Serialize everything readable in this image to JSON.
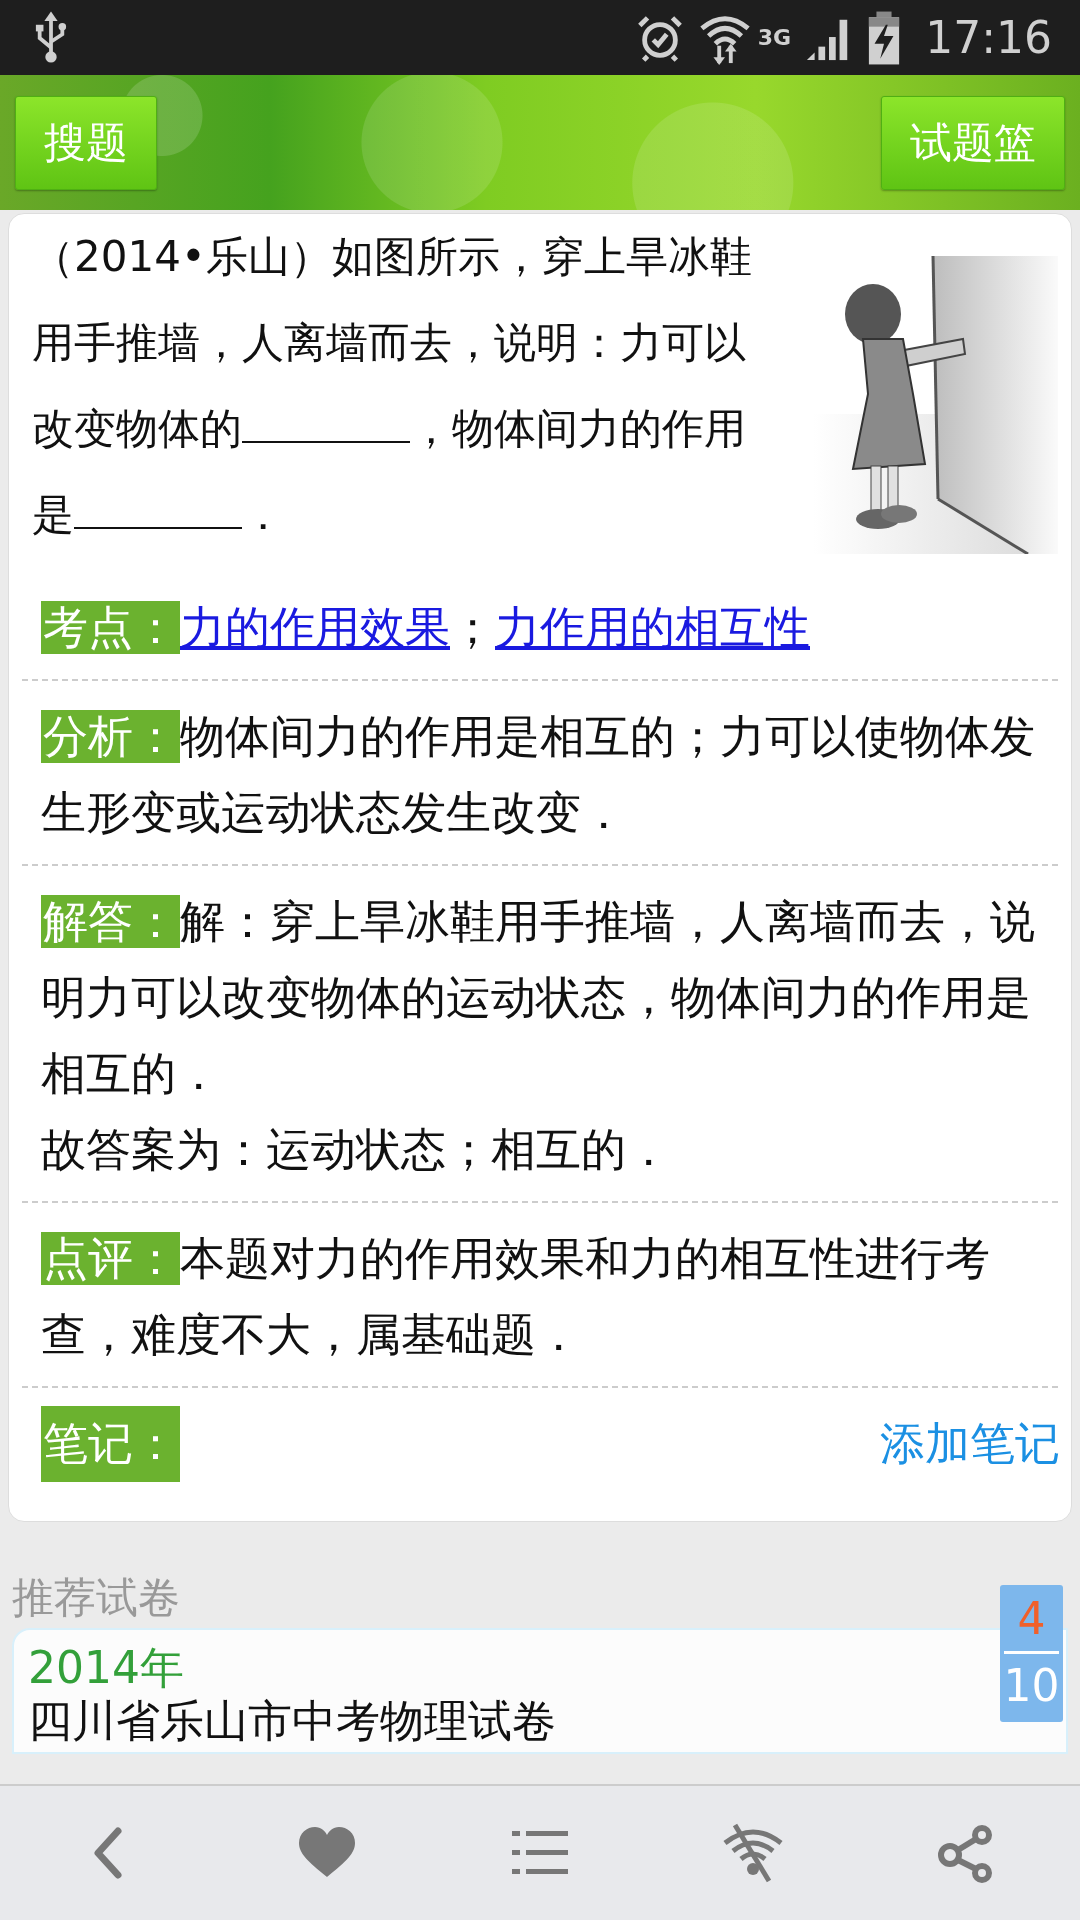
{
  "status_bar": {
    "network": "3G",
    "time": "17:16"
  },
  "header": {
    "left_button": "搜题",
    "right_button": "试题篮"
  },
  "question": {
    "parts": [
      {
        "kind": "text",
        "text": "（2014•乐山）如图所示，穿上旱冰鞋用手推墙，人离墙而去，说明：力可以改变物体的"
      },
      {
        "kind": "blank"
      },
      {
        "kind": "text",
        "text": "，物体间力的作用是"
      },
      {
        "kind": "blank"
      },
      {
        "kind": "text",
        "text": "．"
      }
    ]
  },
  "sections": [
    {
      "kind": "links",
      "label": "考点：",
      "links": [
        "力的作用效果",
        "力作用的相互性"
      ],
      "separator": "；"
    },
    {
      "kind": "text",
      "label": "分析：",
      "lines": [
        "物体间力的作用是相互的；力可以使物体发生形变或运动状态发生改变．"
      ]
    },
    {
      "kind": "text",
      "label": "解答：",
      "lines": [
        "解：穿上旱冰鞋用手推墙，人离墙而去，说明力可以改变物体的运动状态，物体间力的作用是相互的．",
        "故答案为：运动状态；相互的．"
      ]
    },
    {
      "kind": "text",
      "label": "点评：",
      "lines": [
        "本题对力的作用效果和力的相互性进行考查，难度不大，属基础题．"
      ]
    },
    {
      "kind": "note",
      "label": "笔记：",
      "action": "添加笔记"
    }
  ],
  "recommended": {
    "title": "推荐试卷",
    "papers": [
      {
        "year": "2014年",
        "name": "四川省乐山市中考物理试卷"
      }
    ]
  },
  "pager": {
    "current": "4",
    "total": "10"
  },
  "bottom_nav": [
    {
      "kind": "back"
    },
    {
      "kind": "favorite"
    },
    {
      "kind": "list"
    },
    {
      "kind": "offline"
    },
    {
      "kind": "share"
    }
  ]
}
